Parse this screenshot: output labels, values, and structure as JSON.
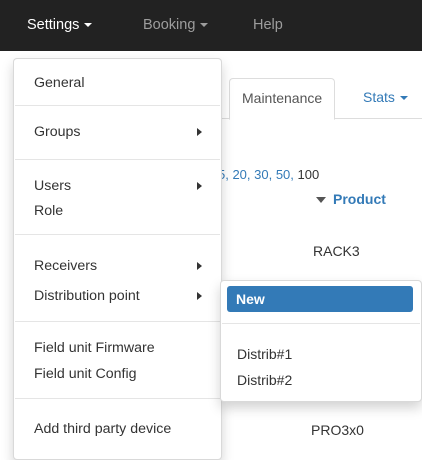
{
  "navbar": {
    "settings": "Settings",
    "booking": "Booking",
    "help": "Help"
  },
  "tabs": {
    "maintenance": "Maintenance",
    "stats": "Stats"
  },
  "page_sizes": {
    "options": "5, 20, 30, 50,",
    "current": "100"
  },
  "table": {
    "product_header": "Product",
    "rows": [
      "RACK3",
      "PRO3x0"
    ]
  },
  "settings_menu": {
    "general": "General",
    "groups": "Groups",
    "users": "Users",
    "role": "Role",
    "receivers": "Receivers",
    "distribution_point": "Distribution point",
    "field_unit_firmware": "Field unit Firmware",
    "field_unit_config": "Field unit Config",
    "add_third_party_device": "Add third party device"
  },
  "distribution_submenu": {
    "new": "New",
    "items": [
      "Distrib#1",
      "Distrib#2"
    ]
  },
  "colors": {
    "navbar_bg": "#222222",
    "accent": "#337ab7"
  }
}
